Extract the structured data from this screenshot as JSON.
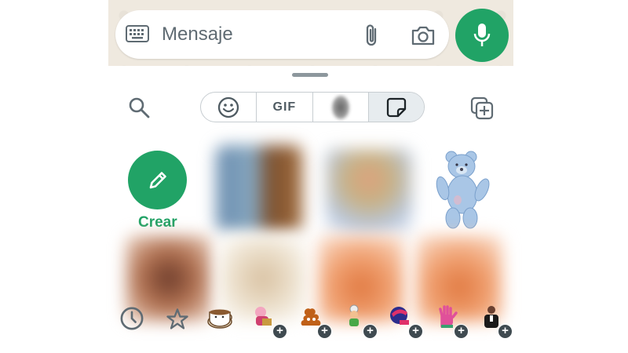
{
  "composer": {
    "placeholder": "Mensaje"
  },
  "sticker_panel": {
    "create_label": "Crear",
    "tabs": [
      {
        "name": "emoji",
        "icon": "smiley-icon"
      },
      {
        "name": "gif",
        "label": "GIF"
      },
      {
        "name": "avatar",
        "icon": "avatar-icon"
      },
      {
        "name": "stickers",
        "icon": "sticker-icon",
        "active": true
      }
    ]
  },
  "colors": {
    "accent": "#21a366",
    "icon_gray": "#5f6b73"
  }
}
